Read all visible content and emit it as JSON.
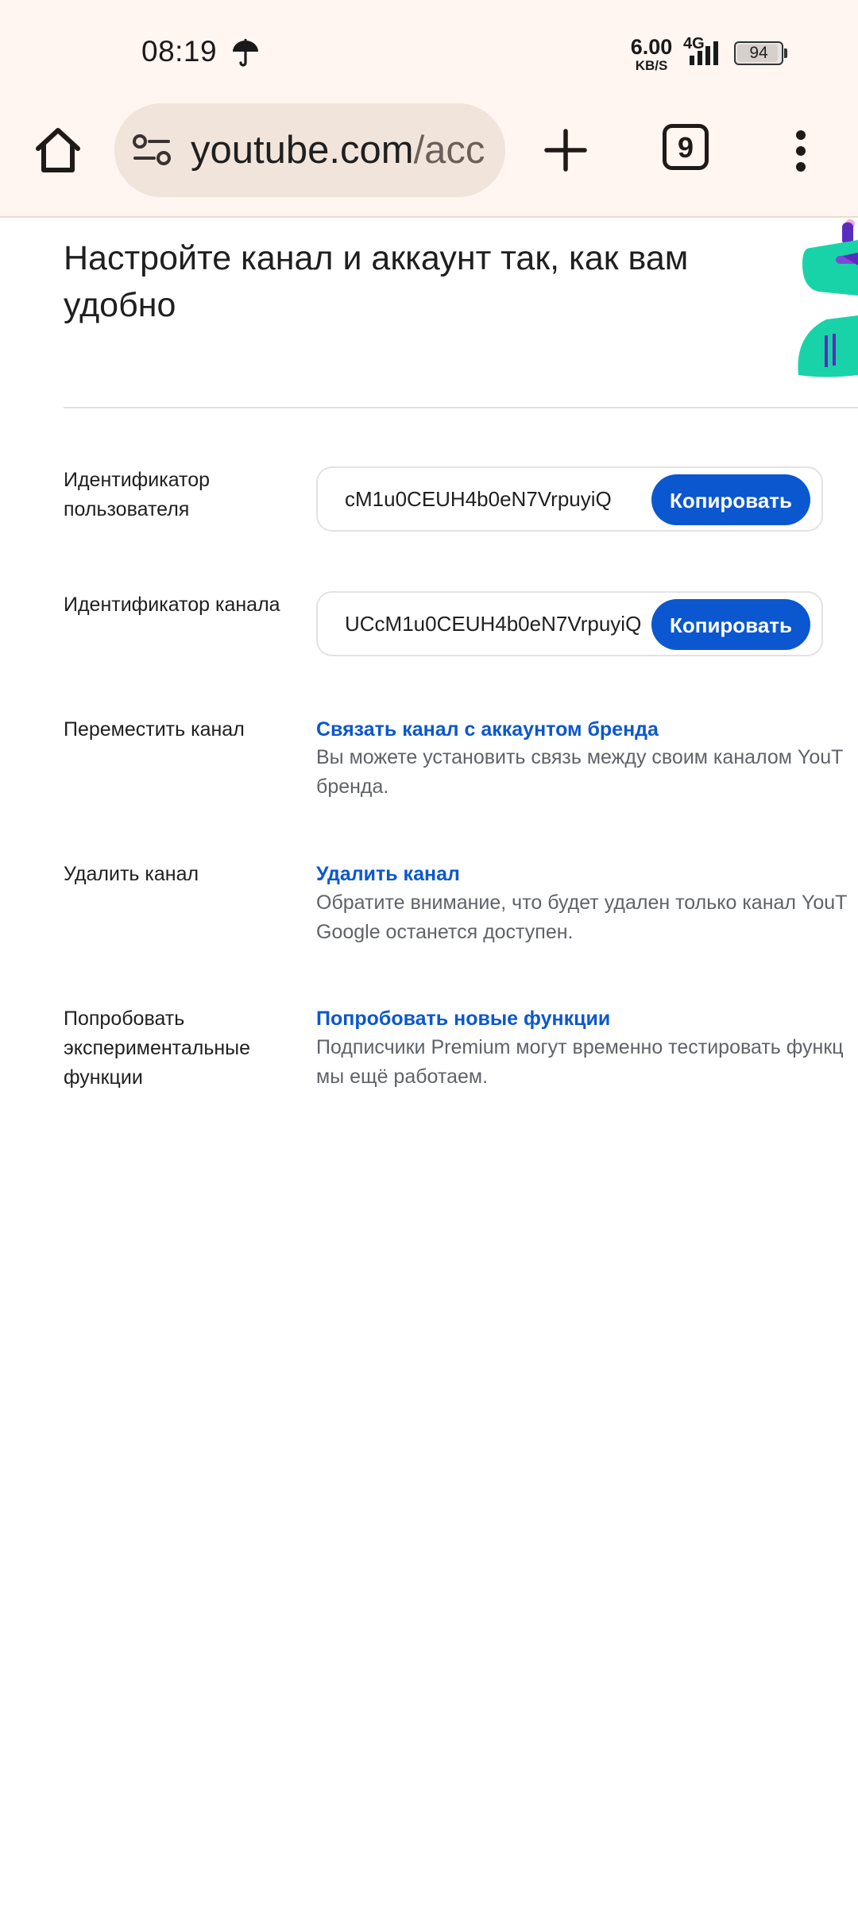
{
  "status_bar": {
    "time": "08:19",
    "network_speed": "6.00",
    "network_speed_unit": "KB/S",
    "network_type": "4G",
    "battery": "94",
    "battery_level": 0.94
  },
  "toolbar": {
    "url_host": "youtube.com",
    "url_rest": "/acc",
    "tab_count": "9"
  },
  "main": {
    "heading": "Настройте канал и аккаунт так, как вам удобно",
    "user_id": {
      "label": "Идентификатор пользователя",
      "value": "cM1u0CEUH4b0eN7VrpuyiQ",
      "button": "Копировать"
    },
    "channel_id": {
      "label": "Идентификатор канала",
      "value": "UCcM1u0CEUH4b0eN7VrpuyiQ",
      "button": "Копировать"
    },
    "move_channel": {
      "label": "Переместить канал",
      "link": "Связать канал с аккаунтом бренда",
      "description": "Вы можете установить связь между своим каналом YouT\nбренда."
    },
    "delete_channel": {
      "label": "Удалить канал",
      "link": "Удалить канал",
      "description": "Обратите внимание, что будет удален только канал YouT\nGoogle останется доступен."
    },
    "experimental": {
      "label": "Попробовать экспериментальные функции",
      "link": "Попробовать новые функции",
      "description": "Подписчики Premium могут временно тестировать функц\nмы ещё работаем."
    }
  },
  "colors": {
    "accent": "#0b57d0",
    "toolbar_bg": "#fff5f1",
    "url_bar_bg": "#f1e4da"
  }
}
